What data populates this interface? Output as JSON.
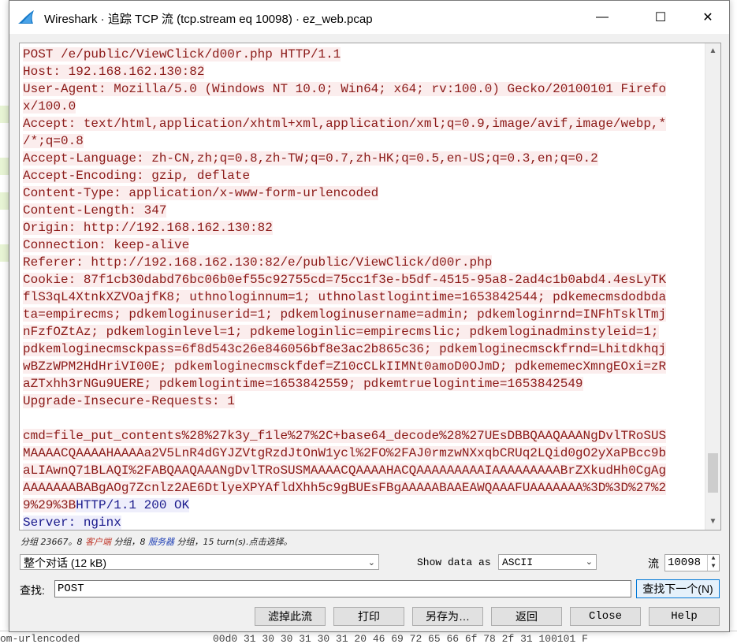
{
  "window": {
    "title": "Wireshark · 追踪 TCP 流 (tcp.stream eq 10098) · ez_web.pcap",
    "minimize": "—",
    "maximize": "☐",
    "close": "✕"
  },
  "stream_lines": [
    {
      "type": "client",
      "text": "POST /e/public/ViewClick/d00r.php HTTP/1.1"
    },
    {
      "type": "client",
      "text": "Host: 192.168.162.130:82"
    },
    {
      "type": "client",
      "text": "User-Agent: Mozilla/5.0 (Windows NT 10.0; Win64; x64; rv:100.0) Gecko/20100101 Firefo"
    },
    {
      "type": "client",
      "text": "x/100.0"
    },
    {
      "type": "client",
      "text": "Accept: text/html,application/xhtml+xml,application/xml;q=0.9,image/avif,image/webp,*"
    },
    {
      "type": "client",
      "text": "/*;q=0.8"
    },
    {
      "type": "client",
      "text": "Accept-Language: zh-CN,zh;q=0.8,zh-TW;q=0.7,zh-HK;q=0.5,en-US;q=0.3,en;q=0.2"
    },
    {
      "type": "client",
      "text": "Accept-Encoding: gzip, deflate"
    },
    {
      "type": "client",
      "text": "Content-Type: application/x-www-form-urlencoded"
    },
    {
      "type": "client",
      "text": "Content-Length: 347"
    },
    {
      "type": "client",
      "text": "Origin: http://192.168.162.130:82"
    },
    {
      "type": "client",
      "text": "Connection: keep-alive"
    },
    {
      "type": "client",
      "text": "Referer: http://192.168.162.130:82/e/public/ViewClick/d00r.php"
    },
    {
      "type": "client",
      "text": "Cookie: 87f1cb30dabd76bc06b0ef55c92755cd=75cc1f3e-b5df-4515-95a8-2ad4c1b0abd4.4esLyTK"
    },
    {
      "type": "client",
      "text": "flS3qL4XtnkXZVOajfK8; uthnologinnum=1; uthnolastlogintime=1653842544; pdkemecmsdodbda"
    },
    {
      "type": "client",
      "text": "ta=empirecms; pdkemloginuserid=1; pdkemloginusername=admin; pdkemloginrnd=INFhTsklTmj"
    },
    {
      "type": "client",
      "text": "nFzfOZtAz; pdkemloginlevel=1; pdkemeloginlic=empirecmslic; pdkemloginadminstyleid=1;"
    },
    {
      "type": "client",
      "text": "pdkemloginecmsckpass=6f8d543c26e846056bf8e3ac2b865c36; pdkemloginecmsckfrnd=Lhitdkhqj"
    },
    {
      "type": "client",
      "text": "wBZzWPM2HdHriVI00E; pdkemloginecmsckfdef=Z10cCLkIIMNt0amoD0OJmD; pdkememecXmngEOxi=zR"
    },
    {
      "type": "client",
      "text": "aZTxhh3rNGu9UERE; pdkemlogintime=1653842559; pdkemtruelogintime=1653842549"
    },
    {
      "type": "client",
      "text": "Upgrade-Insecure-Requests: 1"
    },
    {
      "type": "blank",
      "text": ""
    },
    {
      "type": "client",
      "text": "cmd=file_put_contents%28%27k3y_f1le%27%2C+base64_decode%28%27UEsDBBQAAQAAANgDvlTRoSUS"
    },
    {
      "type": "client",
      "text": "MAAAACQAAAAHAAAAa2V5LnR4dGYJZVtgRzdJtOnW1ycl%2FO%2FAJ0rmzwNXxqbCRUq2LQid0gO2yXaPBcc9b"
    },
    {
      "type": "client",
      "text": "aLIAwnQ71BLAQI%2FABQAAQAAANgDvlTRoSUSMAAAACQAAAAHACQAAAAAAAAAIAAAAAAAAABrZXkudHh0CgAg"
    },
    {
      "type": "client",
      "text": "AAAAAAABABgAOg7Zcnlz2AE6DtlyeXPYAfldXhh5c9gBUEsFBgAAAAABAAEAWQAAAFUAAAAAAA%3D%3D%27%2"
    },
    {
      "type": "mixed",
      "client": "9%29%3B",
      "server": "HTTP/1.1 200 OK"
    },
    {
      "type": "server",
      "text": "Server: nginx"
    }
  ],
  "status": {
    "prefix": "分组 23667。8 ",
    "client": "客户端",
    "middle": " 分组，8 ",
    "server": "服务器",
    "suffix": " 分组，15 turn(s).点击选择。"
  },
  "controls": {
    "conversation_select": "整个对话 (12 kB)",
    "show_data_label": "Show data as",
    "show_data_value": "ASCII",
    "stream_label": "流",
    "stream_value": "10098",
    "find_label": "查找:",
    "find_value": "POST",
    "find_next": "查找下一个(N)"
  },
  "buttons": {
    "filter_out": "滤掉此流",
    "print": "打印",
    "save_as": "另存为…",
    "back": "返回",
    "close": "Close",
    "help": "Help"
  },
  "background": {
    "bottom_left": "om-urlencoded",
    "bottom_hex": "00d0   31 30 30 31 30 31 20 46   69 72 65 66 6f 78 2f 31    100101 F"
  },
  "colors": {
    "client_text": "#8b1a18",
    "client_bg": "#fbeded",
    "server_text": "#1a1a8c",
    "server_bg": "#eeeefb"
  }
}
